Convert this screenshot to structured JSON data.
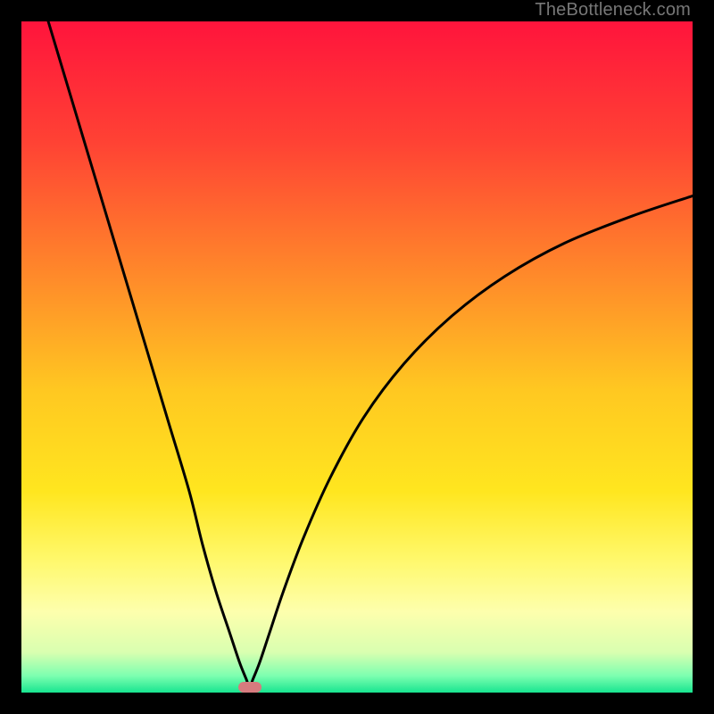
{
  "watermark": "TheBottleneck.com",
  "chart_data": {
    "type": "line",
    "title": "",
    "xlabel": "",
    "ylabel": "",
    "xlim": [
      0,
      100
    ],
    "ylim": [
      0,
      100
    ],
    "grid": false,
    "legend": false,
    "background_gradient": {
      "stops": [
        {
          "pos": 0.0,
          "color": "#ff143c"
        },
        {
          "pos": 0.18,
          "color": "#ff4234"
        },
        {
          "pos": 0.38,
          "color": "#ff8a2a"
        },
        {
          "pos": 0.55,
          "color": "#ffc આ21"
        },
        {
          "pos": 0.7,
          "color": "#ffe61f"
        },
        {
          "pos": 0.8,
          "color": "#fff86a"
        },
        {
          "pos": 0.88,
          "color": "#fdffad"
        },
        {
          "pos": 0.94,
          "color": "#d9ffb0"
        },
        {
          "pos": 0.975,
          "color": "#7dffb0"
        },
        {
          "pos": 1.0,
          "color": "#18e590"
        }
      ]
    },
    "series": [
      {
        "name": "bottleneck-curve",
        "color": "#000000",
        "x": [
          4,
          7,
          10,
          13,
          16,
          19,
          22,
          25,
          27,
          29,
          31,
          32.5,
          33.5,
          34,
          34.5,
          35.5,
          37,
          39,
          42,
          46,
          51,
          57,
          64,
          72,
          81,
          91,
          100
        ],
        "y": [
          100,
          90,
          80,
          70,
          60,
          50,
          40,
          30,
          22,
          15,
          9,
          4.5,
          2,
          0.8,
          2,
          4.5,
          9,
          15,
          23,
          32,
          41,
          49,
          56,
          62,
          67,
          71,
          74
        ]
      }
    ],
    "marker": {
      "x": 34,
      "y": 0.8,
      "shape": "rounded-rect",
      "color": "#d67b7e"
    }
  }
}
